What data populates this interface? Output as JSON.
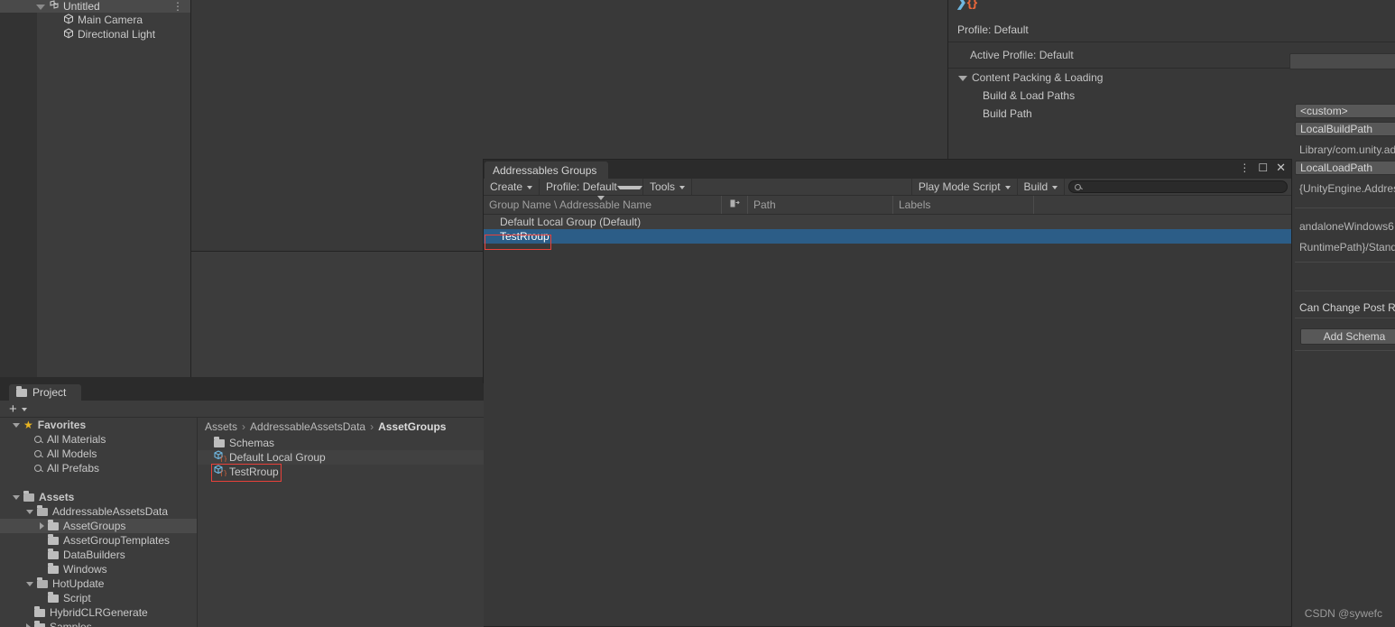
{
  "hierarchy": {
    "scene_name": "Untitled",
    "scene_icon": "scene-icon",
    "kebab_icon": "kebab-menu-icon",
    "items": [
      {
        "label": "Main Camera",
        "icon": "gameobject-cube-icon"
      },
      {
        "label": "Directional Light",
        "icon": "gameobject-cube-icon"
      }
    ]
  },
  "inspector": {
    "logo_icon": "addressables-logo-icon",
    "profile_title": "Profile: Default",
    "active_profile": "Active Profile: Default",
    "section_title": "Content Packing & Loading",
    "props": [
      {
        "label": "Build & Load Paths",
        "value": "<custom>"
      },
      {
        "label": "Build Path",
        "value": "LocalBuildPath"
      }
    ],
    "value_rows": [
      "Library/com.unity.addre",
      "LocalLoadPath",
      "{UnityEngine.Addressab",
      "andaloneWindows6",
      "RuntimePath}/Stand"
    ],
    "post_release_label": "Can Change Post R",
    "add_schema_label": "Add Schema"
  },
  "addressables_window": {
    "tab_label": "Addressables Groups",
    "window_buttons": [
      {
        "name": "kebab-menu-icon",
        "glyph": "⋮"
      },
      {
        "name": "maximize-icon",
        "glyph": "□"
      },
      {
        "name": "close-icon",
        "glyph": "✕"
      }
    ],
    "toolbar": {
      "create_label": "Create",
      "profile_label": "Profile: Default",
      "tools_label": "Tools",
      "play_mode_script_label": "Play Mode Script",
      "build_label": "Build",
      "search_value": "",
      "search_placeholder": "",
      "search_icon": "search-icon"
    },
    "columns": [
      {
        "label": "Group Name \\ Addressable Name",
        "sorted": true
      },
      {
        "label": "",
        "icon": "column-toggle-icon"
      },
      {
        "label": "Path"
      },
      {
        "label": "Labels"
      }
    ],
    "rows": [
      {
        "label": "Default Local Group (Default)",
        "selected": false
      },
      {
        "label": "TestRroup",
        "selected": true,
        "annotated": true
      }
    ]
  },
  "project": {
    "tab_label": "Project",
    "tab_icon": "folder-icon",
    "add_label": "+",
    "add_icon": "plus-icon",
    "tree": [
      {
        "label": "Favorites",
        "depth": 0,
        "arrow": "down",
        "icon": "star-icon"
      },
      {
        "label": "All Materials",
        "depth": 1,
        "arrow": "none",
        "icon": "search-icon"
      },
      {
        "label": "All Models",
        "depth": 1,
        "arrow": "none",
        "icon": "search-icon"
      },
      {
        "label": "All Prefabs",
        "depth": 1,
        "arrow": "none",
        "icon": "search-icon"
      },
      {
        "label": "",
        "depth": 0,
        "arrow": "none",
        "icon": "spacer"
      },
      {
        "label": "Assets",
        "depth": 0,
        "arrow": "down",
        "icon": "folder-open-icon"
      },
      {
        "label": "AddressableAssetsData",
        "depth": 1,
        "arrow": "down",
        "icon": "folder-open-icon"
      },
      {
        "label": "AssetGroups",
        "depth": 2,
        "arrow": "right",
        "icon": "folder-icon",
        "highlighted": true
      },
      {
        "label": "AssetGroupTemplates",
        "depth": 2,
        "arrow": "none",
        "icon": "folder-icon"
      },
      {
        "label": "DataBuilders",
        "depth": 2,
        "arrow": "none",
        "icon": "folder-icon"
      },
      {
        "label": "Windows",
        "depth": 2,
        "arrow": "none",
        "icon": "folder-icon"
      },
      {
        "label": "HotUpdate",
        "depth": 1,
        "arrow": "down",
        "icon": "folder-open-icon"
      },
      {
        "label": "Script",
        "depth": 2,
        "arrow": "none",
        "icon": "folder-icon"
      },
      {
        "label": "HybridCLRGenerate",
        "depth": 1,
        "arrow": "none",
        "icon": "folder-icon"
      },
      {
        "label": "Samples",
        "depth": 1,
        "arrow": "right",
        "icon": "folder-icon"
      }
    ],
    "breadcrumb": [
      "Assets",
      "AddressableAssetsData",
      "AssetGroups"
    ],
    "assets": [
      {
        "label": "Schemas",
        "icon": "folder-icon"
      },
      {
        "label": "Default Local Group",
        "icon": "addressable-group-icon"
      },
      {
        "label": "TestRroup",
        "icon": "addressable-group-icon",
        "annotated": true
      }
    ]
  },
  "watermark": "CSDN @sywefc",
  "colors": {
    "selection_blue": "#2c5d87",
    "annotation_red": "#e8413a",
    "panel_bg": "#383838",
    "toolbar_bg": "#3c3c3c"
  }
}
